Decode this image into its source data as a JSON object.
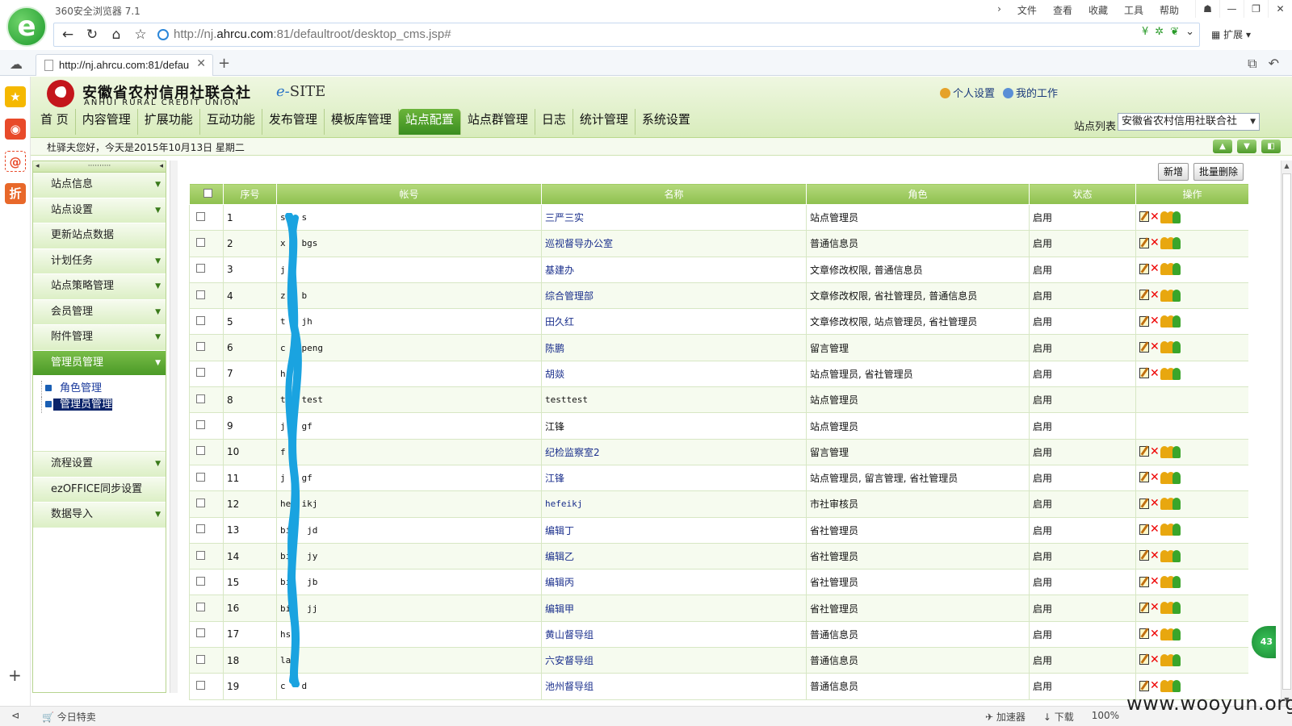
{
  "browser": {
    "name": "360安全浏览器 7.1",
    "menu": [
      "文件",
      "查看",
      "收藏",
      "工具",
      "帮助"
    ],
    "url_prefix": "http://nj.",
    "url_domain": "ahrcu.com",
    "url_suffix": ":81/defaultroot/desktop_cms.jsp#",
    "ext_label": "扩展",
    "tab_title": "http://nj.ahrcu.com:81/defau",
    "status_left": "今日特卖",
    "status_right": [
      "加速器",
      "下载",
      "100%"
    ],
    "watermark": "www.wooyun.org",
    "badge": "43"
  },
  "header": {
    "org_cn": "安徽省农村信用社联合社",
    "org_en": "ANHUI RURAL CREDIT UNION",
    "product_prefix": "e-",
    "product_name": "SITE",
    "link_personal": "个人设置",
    "link_work": "我的工作",
    "sitelist_label": "站点列表",
    "sitelist_value": "安徽省农村信用社联合社",
    "greeting": "杜驿夫您好，今天是2015年10月13日 星期二"
  },
  "nav": [
    "首 页",
    "内容管理",
    "扩展功能",
    "互动功能",
    "发布管理",
    "模板库管理",
    "站点配置",
    "站点群管理",
    "日志",
    "统计管理",
    "系统设置"
  ],
  "sidebar": {
    "head_dots": "··········",
    "items_top": [
      {
        "label": "站点信息",
        "arrow": true
      },
      {
        "label": "站点设置",
        "arrow": true
      },
      {
        "label": "更新站点数据",
        "arrow": false
      },
      {
        "label": "计划任务",
        "arrow": true
      },
      {
        "label": "站点策略管理",
        "arrow": true
      },
      {
        "label": "会员管理",
        "arrow": true
      },
      {
        "label": "附件管理",
        "arrow": true
      },
      {
        "label": "管理员管理",
        "arrow": true,
        "active": true
      }
    ],
    "sub": [
      "角色管理",
      "管理员管理"
    ],
    "items_bottom": [
      {
        "label": "流程设置",
        "arrow": true
      },
      {
        "label": "ezOFFICE同步设置",
        "arrow": false
      },
      {
        "label": "数据导入",
        "arrow": true
      }
    ]
  },
  "toolbar": {
    "add": "新增",
    "batch_delete": "批量删除"
  },
  "table": {
    "headers": [
      "序号",
      "帐号",
      "名称",
      "角色",
      "状态",
      "操作"
    ],
    "rows": [
      {
        "no": "1",
        "acct": "ss  s",
        "name": "三严三实",
        "role": "站点管理员",
        "status": "启用",
        "ops": true,
        "link": true
      },
      {
        "no": "2",
        "acct": "x   bgs",
        "name": "巡视督导办公室",
        "role": "普通信息员",
        "status": "启用",
        "ops": true,
        "link": true
      },
      {
        "no": "3",
        "acct": "j  ",
        "name": "基建办",
        "role": "文章修改权限, 普通信息员",
        "status": "启用",
        "ops": true,
        "link": true
      },
      {
        "no": "4",
        "acct": "z   b",
        "name": "综合管理部",
        "role": "文章修改权限, 省社管理员, 普通信息员",
        "status": "启用",
        "ops": true,
        "link": true
      },
      {
        "no": "5",
        "acct": "t   jh",
        "name": "田久红",
        "role": "文章修改权限, 站点管理员, 省社管理员",
        "status": "启用",
        "ops": true,
        "link": true
      },
      {
        "no": "6",
        "acct": "c   peng",
        "name": "陈鹏",
        "role": "留言管理",
        "status": "启用",
        "ops": true,
        "link": true
      },
      {
        "no": "7",
        "acct": "h  y",
        "name": "胡燚",
        "role": "站点管理员, 省社管理员",
        "status": "启用",
        "ops": true,
        "link": true
      },
      {
        "no": "8",
        "acct": "t   test",
        "name": "testtest",
        "role": "站点管理员",
        "status": "启用",
        "ops": false,
        "link": false,
        "mono": true
      },
      {
        "no": "9",
        "acct": "j   gf",
        "name": "江锋",
        "role": "站点管理员",
        "status": "启用",
        "ops": false,
        "link": false
      },
      {
        "no": "10",
        "acct": "f  ",
        "name": "纪检监察室2",
        "role": "留言管理",
        "status": "启用",
        "ops": true,
        "link": true
      },
      {
        "no": "11",
        "acct": "j   gf",
        "name": "江锋",
        "role": "站点管理员, 留言管理, 省社管理员",
        "status": "启用",
        "ops": true,
        "link": true
      },
      {
        "no": "12",
        "acct": "he  ikj",
        "name": "hefeikj",
        "role": "市社审核员",
        "status": "启用",
        "ops": true,
        "link": true,
        "mono": true
      },
      {
        "no": "13",
        "acct": "bi   jd",
        "name": "编辑丁",
        "role": "省社管理员",
        "status": "启用",
        "ops": true,
        "link": true
      },
      {
        "no": "14",
        "acct": "bi   jy",
        "name": "编辑乙",
        "role": "省社管理员",
        "status": "启用",
        "ops": true,
        "link": true
      },
      {
        "no": "15",
        "acct": "bi   jb",
        "name": "编辑丙",
        "role": "省社管理员",
        "status": "启用",
        "ops": true,
        "link": true
      },
      {
        "no": "16",
        "acct": "bi   jj",
        "name": "编辑甲",
        "role": "省社管理员",
        "status": "启用",
        "ops": true,
        "link": true
      },
      {
        "no": "17",
        "acct": "hs  ",
        "name": "黄山督导组",
        "role": "普通信息员",
        "status": "启用",
        "ops": true,
        "link": true
      },
      {
        "no": "18",
        "acct": "la  ",
        "name": "六安督导组",
        "role": "普通信息员",
        "status": "启用",
        "ops": true,
        "link": true
      },
      {
        "no": "19",
        "acct": "c   d",
        "name": "池州督导组",
        "role": "普通信息员",
        "status": "启用",
        "ops": true,
        "link": true
      }
    ]
  },
  "colors": {
    "accent_green": "#5aa832",
    "header_green": "#9acb62",
    "link_blue": "#1a2f8c",
    "redaction": "#1aa3e0"
  }
}
